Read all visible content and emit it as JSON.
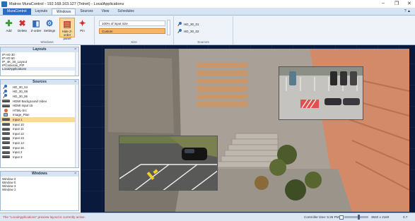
{
  "window": {
    "title": "Matrox MuraControl - 192.168.163.127 (Telnet) - LocalApplications",
    "controls": {
      "minimize": "–",
      "maximize": "❐",
      "close": "✕"
    }
  },
  "ribbon_tabs": [
    {
      "label": "MuraControl",
      "kind": "file"
    },
    {
      "label": "Layouts",
      "kind": "normal"
    },
    {
      "label": "Windows",
      "kind": "active"
    },
    {
      "label": "Sources",
      "kind": "normal"
    },
    {
      "label": "View",
      "kind": "normal"
    },
    {
      "label": "Schedules",
      "kind": "normal"
    }
  ],
  "ribbon_help": "? ▲",
  "windows_group": {
    "label": "Windows",
    "buttons": [
      {
        "label": "Add",
        "icon": "add-icon",
        "glyph": "✚",
        "color": "#3a9b35"
      },
      {
        "label": "Delete",
        "icon": "delete-icon",
        "glyph": "✖",
        "color": "#d32f2f"
      },
      {
        "label": "Z-order",
        "icon": "z-order-icon",
        "glyph": "◧",
        "color": "#2d6cc0"
      },
      {
        "label": "Settings",
        "icon": "settings-icon",
        "glyph": "⚙",
        "color": "#2d6cc0"
      },
      {
        "label": "Hide Z-order panel",
        "icon": "hide-z-order-panel-icon",
        "glyph": "▤",
        "color": "#c0392b"
      },
      {
        "label": "Pin",
        "icon": "pin-icon",
        "glyph": "✦",
        "color": "#d32f2f"
      }
    ]
  },
  "size_group": {
    "label": "Size",
    "field_value": "100% of input size",
    "selected_option": "Custom"
  },
  "sources_group": {
    "label": "Sources",
    "items": [
      "HD_30_01",
      "HD_30_02"
    ]
  },
  "layouts_panel": {
    "title": "Layouts",
    "close": "×",
    "items": [
      "IP HD 30",
      "IP HD 60",
      "IP_4K_30_Layout",
      "IPCameras_PIP",
      "LocalApplications"
    ],
    "selected_index": 4
  },
  "sources_panel": {
    "title": "Sources",
    "close": "×",
    "items": [
      {
        "label": "HD_30_04",
        "icon": "pin"
      },
      {
        "label": "HD_30_08",
        "icon": "pin"
      },
      {
        "label": "HD_30_06",
        "icon": "pin"
      },
      {
        "label": "HDMI Background Video",
        "icon": "dev"
      },
      {
        "label": "HDMI Input 15",
        "icon": "dev"
      },
      {
        "label": "HTML-Src",
        "icon": "globe"
      },
      {
        "label": "Image_Plan",
        "icon": "img"
      },
      {
        "label": "Input 1",
        "icon": "dev"
      },
      {
        "label": "Input 10",
        "icon": "dev"
      },
      {
        "label": "Input 11",
        "icon": "dev"
      },
      {
        "label": "Input 12",
        "icon": "dev"
      },
      {
        "label": "Input 13",
        "icon": "dev"
      },
      {
        "label": "Input 14",
        "icon": "dev"
      },
      {
        "label": "Input 16",
        "icon": "dev"
      },
      {
        "label": "Input 2",
        "icon": "dev"
      },
      {
        "label": "Input 3",
        "icon": "dev"
      }
    ],
    "selected_index": 7
  },
  "windows_panel": {
    "title": "Windows",
    "close": "×",
    "items": [
      "Window 2",
      "Window 0",
      "Window 3",
      "Window 1"
    ]
  },
  "status": {
    "message": "The \"LocalApplications\" preview layout is currently active.",
    "controller_time": "Controller time: 5:26 PM",
    "zoom_fraction": 0.6,
    "resolution": "3840 x 2160",
    "zoom_level": "0.7"
  },
  "colors": {
    "accent": "#2b6cc4",
    "selection": "#fbd99a",
    "canvas": "#0a1a3c",
    "error_text": "#c0392b"
  }
}
